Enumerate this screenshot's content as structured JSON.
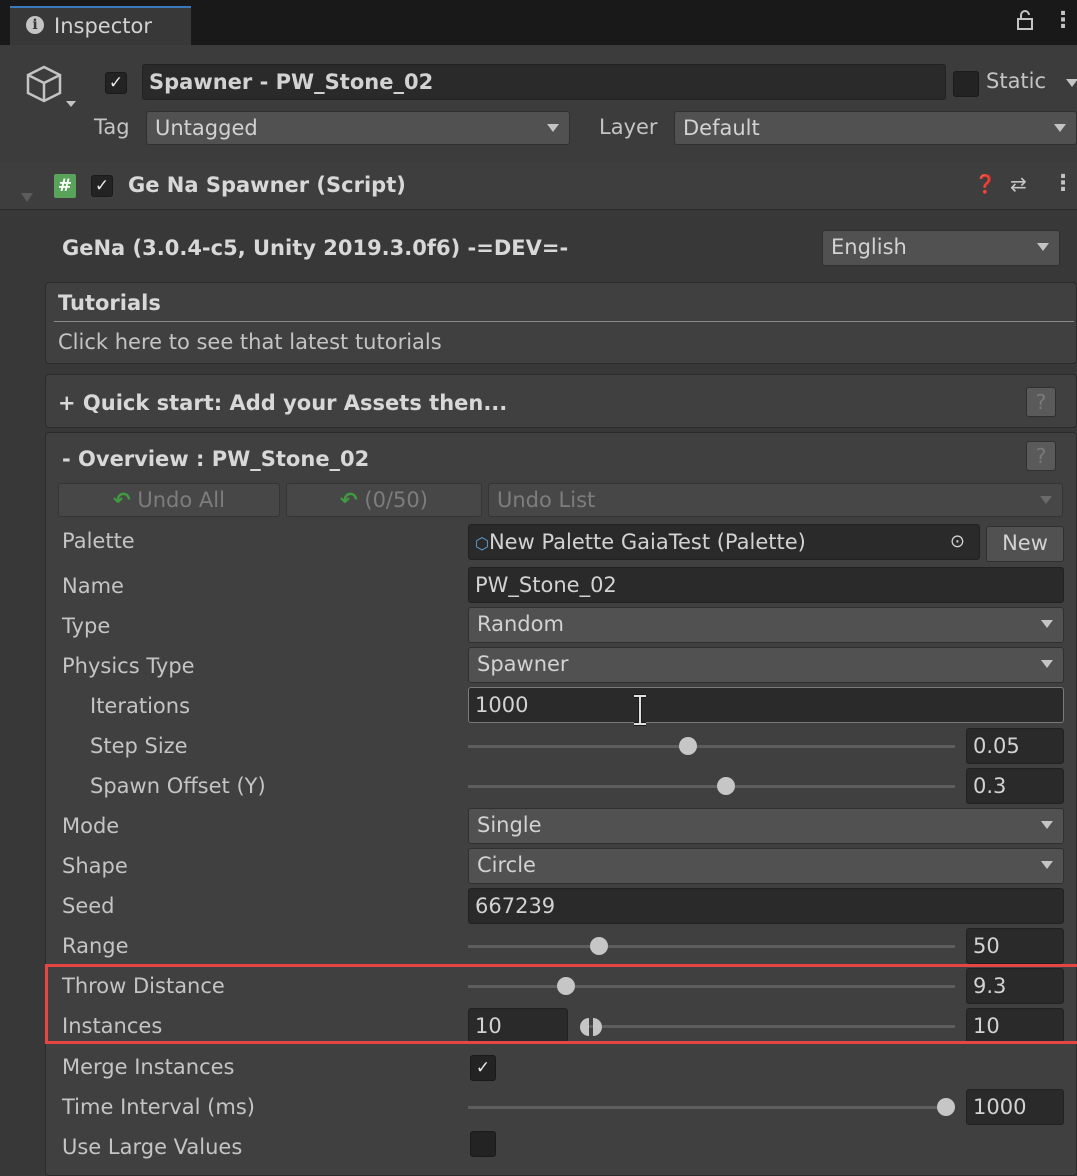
{
  "window": {
    "tab_title": "Inspector"
  },
  "header": {
    "object_name": "Spawner - PW_Stone_02",
    "static_label": "Static",
    "tag_label": "Tag",
    "tag_value": "Untagged",
    "layer_label": "Layer",
    "layer_value": "Default"
  },
  "component": {
    "title": "Ge Na Spawner (Script)"
  },
  "version": {
    "text": "GeNa (3.0.4-c5, Unity 2019.3.0f6) -=DEV=-",
    "language": "English"
  },
  "tutorials": {
    "title": "Tutorials",
    "link": "Click here to see that latest tutorials"
  },
  "quick_start": {
    "title": "+ Quick start: Add your Assets then..."
  },
  "overview": {
    "title": "- Overview : PW_Stone_02",
    "undo_all": "Undo All",
    "undo_count": "(0/50)",
    "undo_list": "Undo List",
    "help": "?"
  },
  "fields": {
    "palette": {
      "label": "Palette",
      "value": "New Palette GaiaTest (Palette)",
      "new_button": "New"
    },
    "name": {
      "label": "Name",
      "value": "PW_Stone_02"
    },
    "type": {
      "label": "Type",
      "value": "Random"
    },
    "physics_type": {
      "label": "Physics Type",
      "value": "Spawner"
    },
    "iterations": {
      "label": "Iterations",
      "value": "1000"
    },
    "step_size": {
      "label": "Step Size",
      "value": "0.05",
      "fraction": 0.45
    },
    "spawn_offset": {
      "label": "Spawn Offset (Y)",
      "value": "0.3",
      "fraction": 0.53
    },
    "mode": {
      "label": "Mode",
      "value": "Single"
    },
    "shape": {
      "label": "Shape",
      "value": "Circle"
    },
    "seed": {
      "label": "Seed",
      "value": "667239"
    },
    "range": {
      "label": "Range",
      "value": "50",
      "fraction": 0.26
    },
    "throw_distance": {
      "label": "Throw Distance",
      "value": "9.3",
      "fraction": 0.19
    },
    "instances": {
      "label": "Instances",
      "min_value": "10",
      "max_value": "10"
    },
    "merge_instances": {
      "label": "Merge Instances",
      "checked": true
    },
    "time_interval": {
      "label": "Time Interval (ms)",
      "value": "1000",
      "fraction": 1.0
    },
    "use_large_values": {
      "label": "Use Large Values",
      "checked": false
    }
  },
  "help_symbol": "?"
}
